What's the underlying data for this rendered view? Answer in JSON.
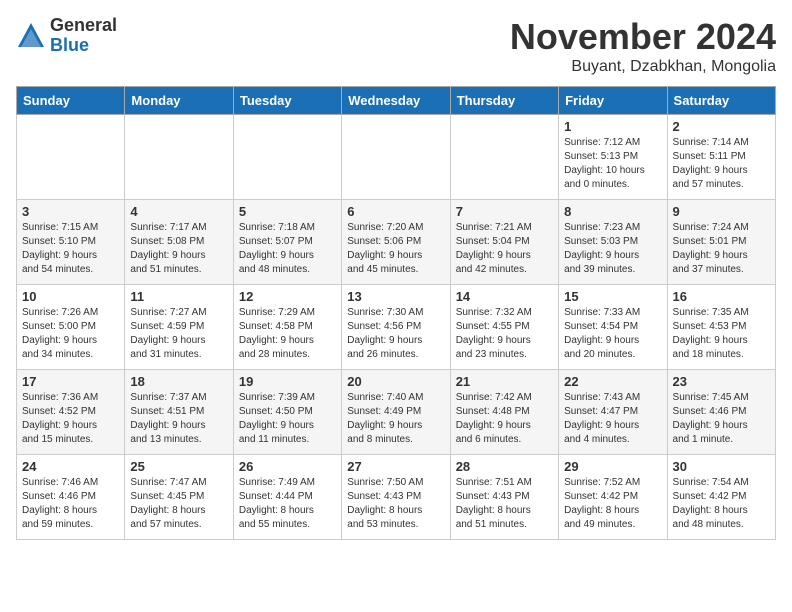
{
  "logo": {
    "general": "General",
    "blue": "Blue"
  },
  "title": "November 2024",
  "location": "Buyant, Dzabkhan, Mongolia",
  "days_of_week": [
    "Sunday",
    "Monday",
    "Tuesday",
    "Wednesday",
    "Thursday",
    "Friday",
    "Saturday"
  ],
  "weeks": [
    {
      "cells": [
        {
          "day": "",
          "info": ""
        },
        {
          "day": "",
          "info": ""
        },
        {
          "day": "",
          "info": ""
        },
        {
          "day": "",
          "info": ""
        },
        {
          "day": "",
          "info": ""
        },
        {
          "day": "1",
          "info": "Sunrise: 7:12 AM\nSunset: 5:13 PM\nDaylight: 10 hours\nand 0 minutes."
        },
        {
          "day": "2",
          "info": "Sunrise: 7:14 AM\nSunset: 5:11 PM\nDaylight: 9 hours\nand 57 minutes."
        }
      ]
    },
    {
      "cells": [
        {
          "day": "3",
          "info": "Sunrise: 7:15 AM\nSunset: 5:10 PM\nDaylight: 9 hours\nand 54 minutes."
        },
        {
          "day": "4",
          "info": "Sunrise: 7:17 AM\nSunset: 5:08 PM\nDaylight: 9 hours\nand 51 minutes."
        },
        {
          "day": "5",
          "info": "Sunrise: 7:18 AM\nSunset: 5:07 PM\nDaylight: 9 hours\nand 48 minutes."
        },
        {
          "day": "6",
          "info": "Sunrise: 7:20 AM\nSunset: 5:06 PM\nDaylight: 9 hours\nand 45 minutes."
        },
        {
          "day": "7",
          "info": "Sunrise: 7:21 AM\nSunset: 5:04 PM\nDaylight: 9 hours\nand 42 minutes."
        },
        {
          "day": "8",
          "info": "Sunrise: 7:23 AM\nSunset: 5:03 PM\nDaylight: 9 hours\nand 39 minutes."
        },
        {
          "day": "9",
          "info": "Sunrise: 7:24 AM\nSunset: 5:01 PM\nDaylight: 9 hours\nand 37 minutes."
        }
      ]
    },
    {
      "cells": [
        {
          "day": "10",
          "info": "Sunrise: 7:26 AM\nSunset: 5:00 PM\nDaylight: 9 hours\nand 34 minutes."
        },
        {
          "day": "11",
          "info": "Sunrise: 7:27 AM\nSunset: 4:59 PM\nDaylight: 9 hours\nand 31 minutes."
        },
        {
          "day": "12",
          "info": "Sunrise: 7:29 AM\nSunset: 4:58 PM\nDaylight: 9 hours\nand 28 minutes."
        },
        {
          "day": "13",
          "info": "Sunrise: 7:30 AM\nSunset: 4:56 PM\nDaylight: 9 hours\nand 26 minutes."
        },
        {
          "day": "14",
          "info": "Sunrise: 7:32 AM\nSunset: 4:55 PM\nDaylight: 9 hours\nand 23 minutes."
        },
        {
          "day": "15",
          "info": "Sunrise: 7:33 AM\nSunset: 4:54 PM\nDaylight: 9 hours\nand 20 minutes."
        },
        {
          "day": "16",
          "info": "Sunrise: 7:35 AM\nSunset: 4:53 PM\nDaylight: 9 hours\nand 18 minutes."
        }
      ]
    },
    {
      "cells": [
        {
          "day": "17",
          "info": "Sunrise: 7:36 AM\nSunset: 4:52 PM\nDaylight: 9 hours\nand 15 minutes."
        },
        {
          "day": "18",
          "info": "Sunrise: 7:37 AM\nSunset: 4:51 PM\nDaylight: 9 hours\nand 13 minutes."
        },
        {
          "day": "19",
          "info": "Sunrise: 7:39 AM\nSunset: 4:50 PM\nDaylight: 9 hours\nand 11 minutes."
        },
        {
          "day": "20",
          "info": "Sunrise: 7:40 AM\nSunset: 4:49 PM\nDaylight: 9 hours\nand 8 minutes."
        },
        {
          "day": "21",
          "info": "Sunrise: 7:42 AM\nSunset: 4:48 PM\nDaylight: 9 hours\nand 6 minutes."
        },
        {
          "day": "22",
          "info": "Sunrise: 7:43 AM\nSunset: 4:47 PM\nDaylight: 9 hours\nand 4 minutes."
        },
        {
          "day": "23",
          "info": "Sunrise: 7:45 AM\nSunset: 4:46 PM\nDaylight: 9 hours\nand 1 minute."
        }
      ]
    },
    {
      "cells": [
        {
          "day": "24",
          "info": "Sunrise: 7:46 AM\nSunset: 4:46 PM\nDaylight: 8 hours\nand 59 minutes."
        },
        {
          "day": "25",
          "info": "Sunrise: 7:47 AM\nSunset: 4:45 PM\nDaylight: 8 hours\nand 57 minutes."
        },
        {
          "day": "26",
          "info": "Sunrise: 7:49 AM\nSunset: 4:44 PM\nDaylight: 8 hours\nand 55 minutes."
        },
        {
          "day": "27",
          "info": "Sunrise: 7:50 AM\nSunset: 4:43 PM\nDaylight: 8 hours\nand 53 minutes."
        },
        {
          "day": "28",
          "info": "Sunrise: 7:51 AM\nSunset: 4:43 PM\nDaylight: 8 hours\nand 51 minutes."
        },
        {
          "day": "29",
          "info": "Sunrise: 7:52 AM\nSunset: 4:42 PM\nDaylight: 8 hours\nand 49 minutes."
        },
        {
          "day": "30",
          "info": "Sunrise: 7:54 AM\nSunset: 4:42 PM\nDaylight: 8 hours\nand 48 minutes."
        }
      ]
    }
  ]
}
